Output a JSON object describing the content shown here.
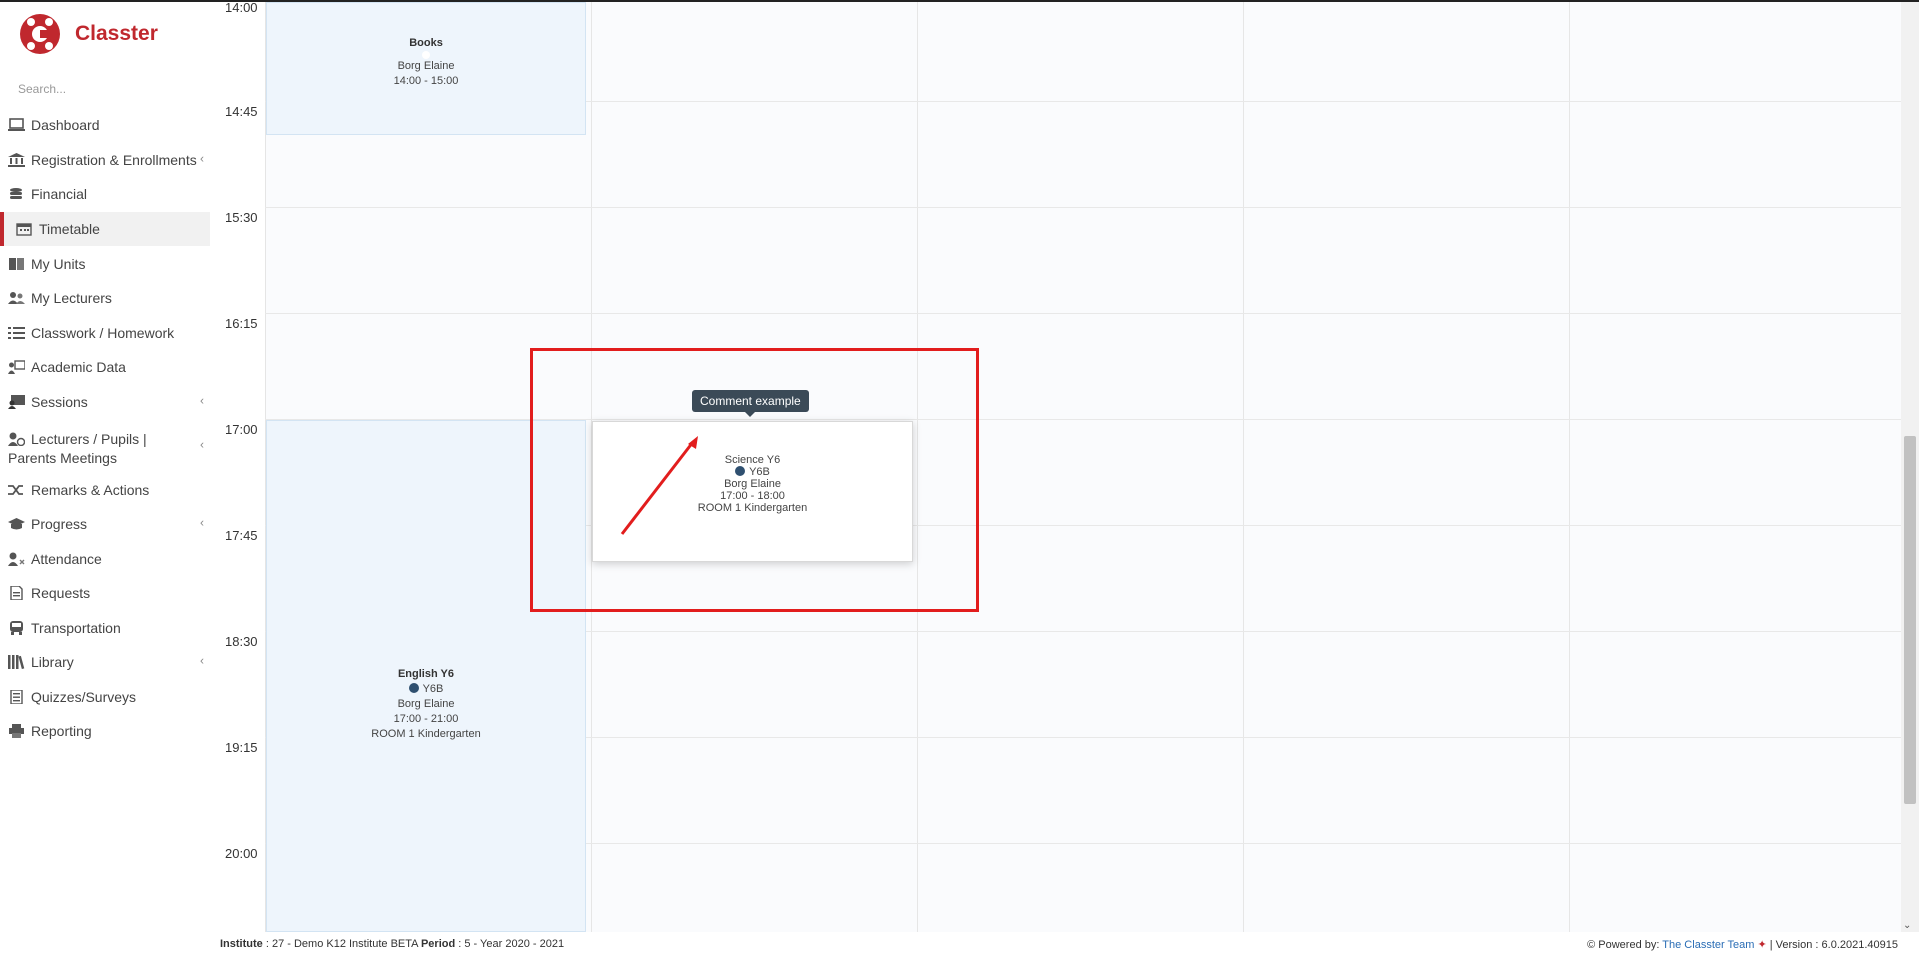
{
  "app": {
    "brand": "Classter"
  },
  "search": {
    "placeholder": "Search..."
  },
  "sidebar": {
    "items": [
      {
        "label": "Dashboard",
        "icon": "laptop-icon"
      },
      {
        "label": "Registration & Enrollments",
        "icon": "institution-icon",
        "has_submenu": true
      },
      {
        "label": "Financial",
        "icon": "coins-icon"
      },
      {
        "label": "Timetable",
        "icon": "calendar-icon",
        "active": true
      },
      {
        "label": "My Units",
        "icon": "book-icon"
      },
      {
        "label": "My Lecturers",
        "icon": "users-icon"
      },
      {
        "label": "Classwork / Homework",
        "icon": "tasks-icon"
      },
      {
        "label": "Academic Data",
        "icon": "presentation-icon"
      },
      {
        "label": "Sessions",
        "icon": "chalkboard-icon",
        "has_submenu": true
      },
      {
        "label": "Lecturers / Pupils | Parents Meetings",
        "icon": "user-clock-icon",
        "has_submenu": true
      },
      {
        "label": "Remarks & Actions",
        "icon": "random-icon"
      },
      {
        "label": "Progress",
        "icon": "graduation-cap-icon",
        "has_submenu": true
      },
      {
        "label": "Attendance",
        "icon": "user-times-icon"
      },
      {
        "label": "Requests",
        "icon": "file-icon"
      },
      {
        "label": "Transportation",
        "icon": "bus-icon"
      },
      {
        "label": "Library",
        "icon": "library-icon",
        "has_submenu": true
      },
      {
        "label": "Quizzes/Surveys",
        "icon": "list-icon"
      },
      {
        "label": "Reporting",
        "icon": "printer-icon"
      }
    ]
  },
  "timetable": {
    "time_labels": [
      "14:00",
      "14:45",
      "15:30",
      "16:15",
      "17:00",
      "17:45",
      "18:30",
      "19:15",
      "20:00"
    ],
    "events": {
      "books": {
        "title": "Books",
        "lecturer": "Borg Elaine",
        "time": "14:00 - 15:00"
      },
      "english": {
        "title": "English Y6",
        "class": "Y6B",
        "lecturer": "Borg Elaine",
        "time": "17:00 - 21:00",
        "room": "ROOM 1 Kindergarten"
      },
      "science": {
        "title": "Science Y6",
        "class": "Y6B",
        "lecturer": "Borg Elaine",
        "time": "17:00 - 18:00",
        "room": "ROOM 1 Kindergarten"
      }
    },
    "tooltip": "Comment example"
  },
  "footer": {
    "institute_label": "Institute",
    "institute_value": ": 27 - Demo K12 Institute BETA",
    "period_label": "Period",
    "period_value": ": 5 - Year 2020 - 2021",
    "powered_by": "Powered by:",
    "team": "The Classter Team",
    "version": "| Version : 6.0.2021.40915"
  },
  "colors": {
    "brand": "#c0282e",
    "annotation": "#e21d1d",
    "event_bg": "#eef5fc",
    "tooltip_bg": "#3b4a57"
  }
}
